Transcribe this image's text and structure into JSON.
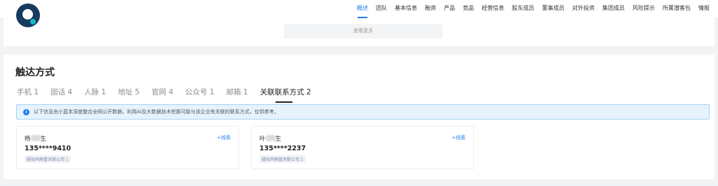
{
  "header": {
    "nav": [
      {
        "label": "概述",
        "active": true
      },
      {
        "label": "团队"
      },
      {
        "label": "基本信息"
      },
      {
        "label": "融资"
      },
      {
        "label": "产品"
      },
      {
        "label": "竞品"
      },
      {
        "label": "经营信息"
      },
      {
        "label": "股东成员"
      },
      {
        "label": "董事成员"
      },
      {
        "label": "对外投资"
      },
      {
        "label": "集团成员"
      },
      {
        "label": "风险提示"
      },
      {
        "label": "所属潜客包"
      },
      {
        "label": "情报"
      }
    ]
  },
  "more_button": {
    "label": "查看更多"
  },
  "contact": {
    "title": "触达方式",
    "tabs": [
      {
        "label": "手机 1"
      },
      {
        "label": "固话 4"
      },
      {
        "label": "人脉 1"
      },
      {
        "label": "地址 5"
      },
      {
        "label": "官网 4"
      },
      {
        "label": "公众号 1"
      },
      {
        "label": "邮箱 1"
      },
      {
        "label": "关联联系方式 2",
        "active": true
      }
    ],
    "notice": "以下信息由小蓝本深度整合全网公开数据，利用AI及大数据技术挖掘可能与该企业有关联的联系方式，仅供参考。",
    "cards": [
      {
        "name_prefix": "杨",
        "name_suffix": "生",
        "phone": "135****9410",
        "badge": "疑似同高管关联公司 1",
        "clue": "+线索"
      },
      {
        "name_prefix": "叶",
        "name_suffix": "生",
        "phone": "135****2237",
        "badge": "疑似同高管关联公司 1",
        "clue": "+线索"
      }
    ]
  },
  "colors": {
    "accent": "#1f7ee8",
    "logo": "#173a5e",
    "logo_dot": "#1ab8c4"
  }
}
